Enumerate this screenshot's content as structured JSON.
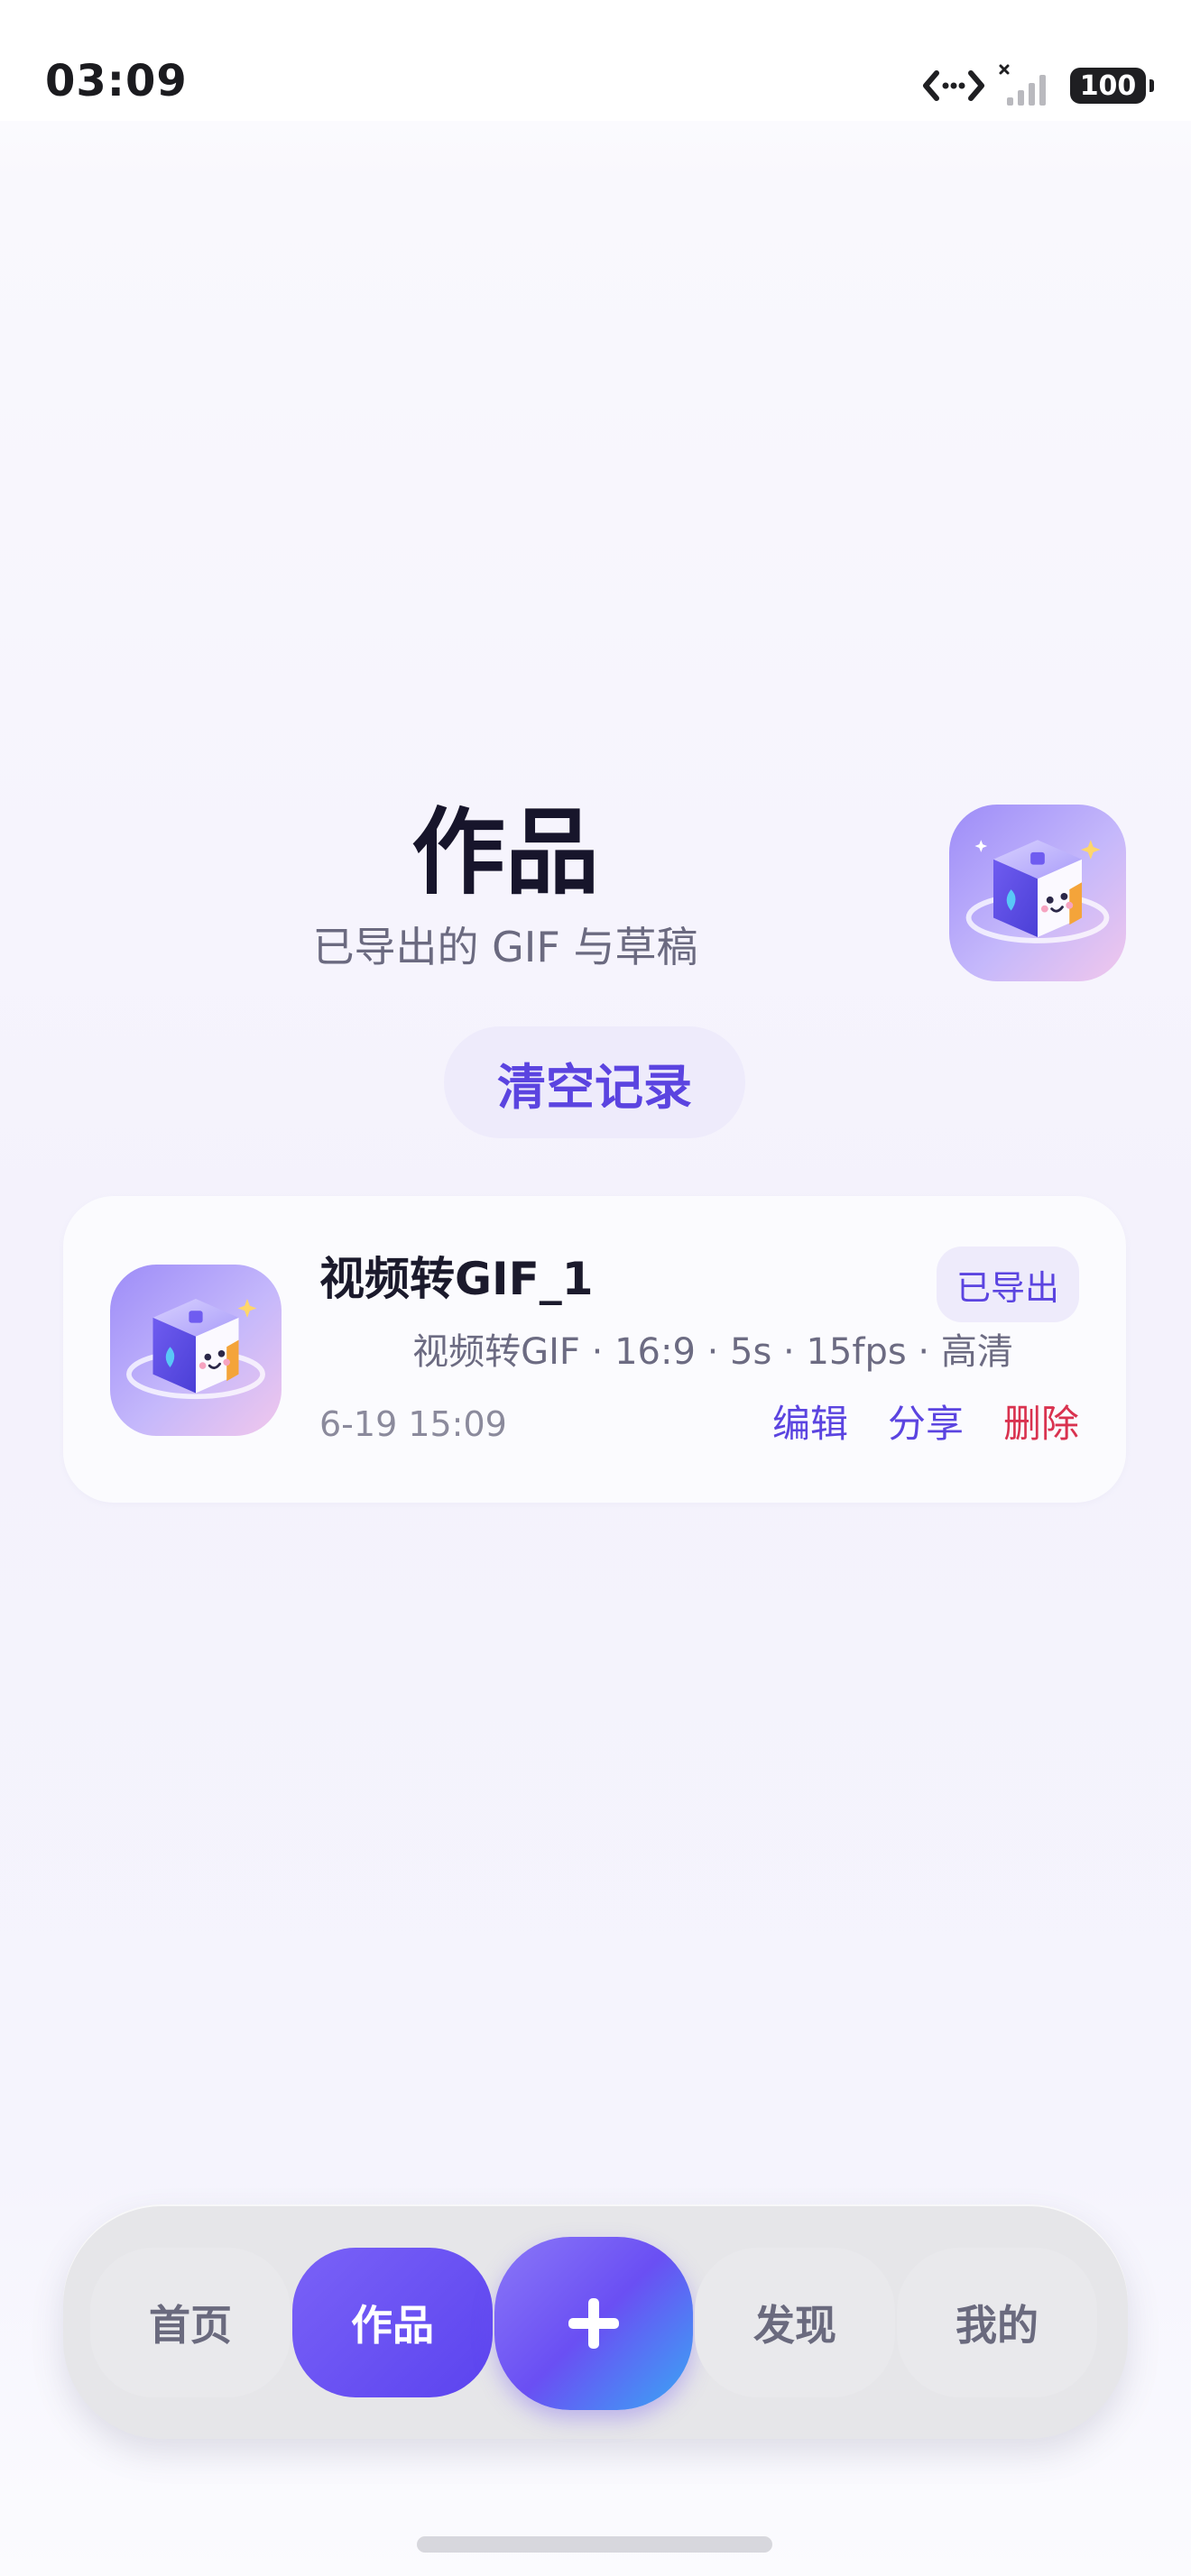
{
  "status_bar": {
    "time": "03:09",
    "battery": "100"
  },
  "header": {
    "title": "作品",
    "subtitle": "已导出的 GIF 与草稿",
    "clear_button": "清空记录"
  },
  "works": [
    {
      "title": "视频转GIF_1",
      "status": "已导出",
      "meta": "视频转GIF · 16:9 · 5s · 15fps · 高清",
      "time": "6-19 15:09",
      "actions": {
        "edit": "编辑",
        "share": "分享",
        "delete": "删除"
      }
    }
  ],
  "nav": {
    "home": "首页",
    "works": "作品",
    "add": "+",
    "discover": "发现",
    "mine": "我的",
    "active": "works"
  },
  "colors": {
    "accent": "#5b44e0",
    "danger": "#d9324f",
    "badge_bg": "#eeebfb"
  }
}
